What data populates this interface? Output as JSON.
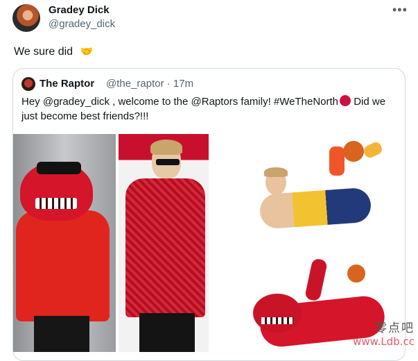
{
  "author": {
    "name": "Gradey Dick",
    "handle": "@gradey_dick",
    "more_icon": "more-horizontal-icon"
  },
  "tweet": {
    "text": "We sure did",
    "emoji": "🤝"
  },
  "quoted": {
    "name": "The Raptor",
    "handle_time": "@the_raptor · 17m",
    "text_before_logo": "Hey @gradey_dick , welcome to the @Raptors family! #WeTheNorth",
    "text_after_logo": " Did we just become best friends?!!!",
    "media": [
      {
        "name": "raptor-mascot-red-jacket-image"
      },
      {
        "name": "gradey-dick-sequin-jacket-image"
      },
      {
        "name": "gradey-dick-lying-pose-image"
      },
      {
        "name": "raptor-mascot-lying-pose-image"
      }
    ]
  },
  "watermark": {
    "chinese": "零点吧",
    "url": "www.Ldb.cc"
  },
  "colors": {
    "text": "#0f1419",
    "secondary": "#536471",
    "border": "#cfd9de",
    "raptors_red": "#ce1141"
  }
}
